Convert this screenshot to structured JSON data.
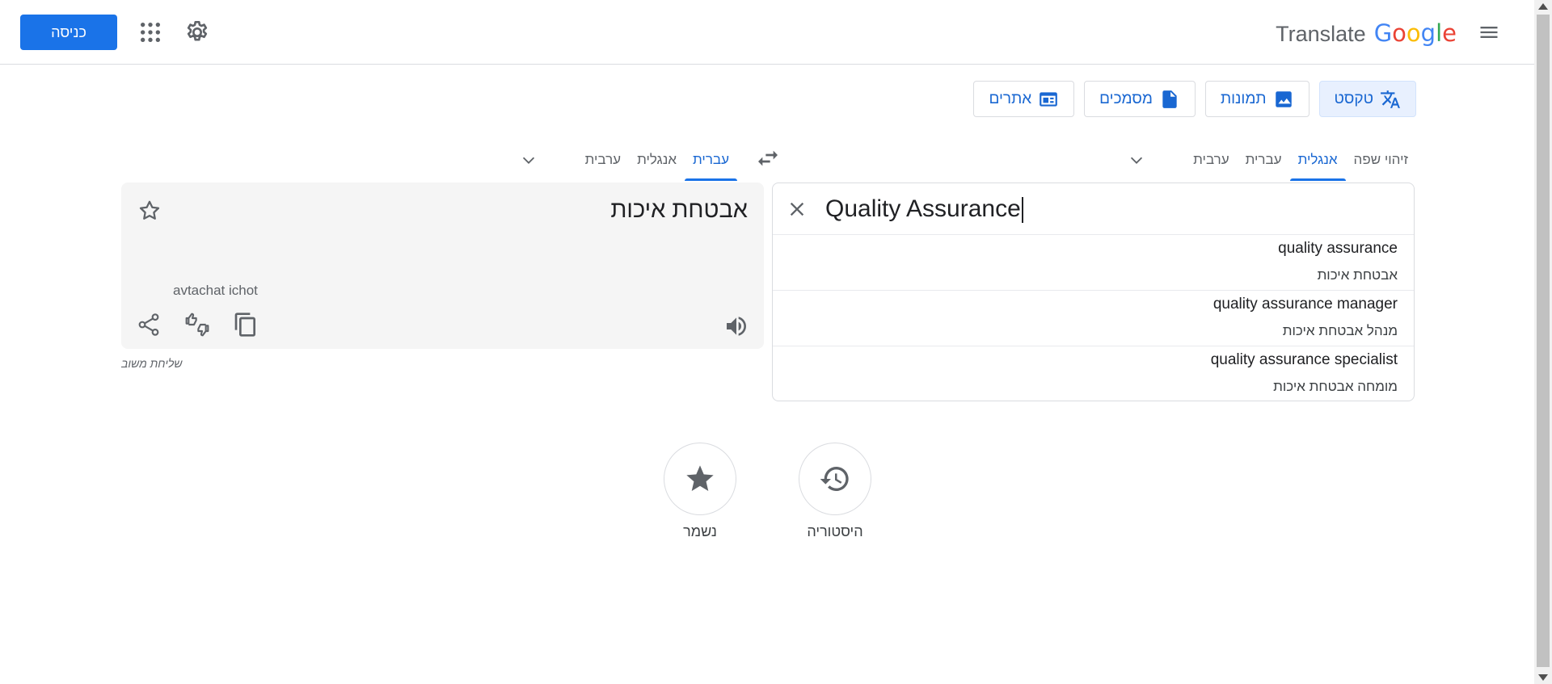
{
  "header": {
    "signin_label": "כניסה",
    "logo_google_letters": [
      "G",
      "o",
      "o",
      "g",
      "l",
      "e"
    ],
    "logo_google_colors": [
      "#4285F4",
      "#EA4335",
      "#FBBC05",
      "#4285F4",
      "#34A853",
      "#EA4335"
    ],
    "logo_translate": "Translate"
  },
  "modes": {
    "text": "טקסט",
    "images": "תמונות",
    "documents": "מסמכים",
    "websites": "אתרים"
  },
  "source_langs": {
    "detect": "זיהוי שפה",
    "english": "אנגלית",
    "hebrew": "עברית",
    "arabic": "ערבית"
  },
  "target_langs": {
    "hebrew": "עברית",
    "english": "אנגלית",
    "arabic": "ערבית"
  },
  "source": {
    "text": "Quality Assurance"
  },
  "suggestions": [
    {
      "en": "quality assurance",
      "he": "אבטחת איכות"
    },
    {
      "en": "quality assurance manager",
      "he": "מנהל אבטחת איכות"
    },
    {
      "en": "quality assurance specialist",
      "he": "מומחה אבטחת איכות"
    }
  ],
  "target": {
    "text": "אבטחת איכות",
    "transliteration": "avtachat ichot",
    "feedback_label": "שליחת משוב"
  },
  "bottom": {
    "history_label": "היסטוריה",
    "saved_label": "נשמר"
  },
  "colors": {
    "accent": "#1a73e8",
    "accent_text": "#1967d2"
  }
}
